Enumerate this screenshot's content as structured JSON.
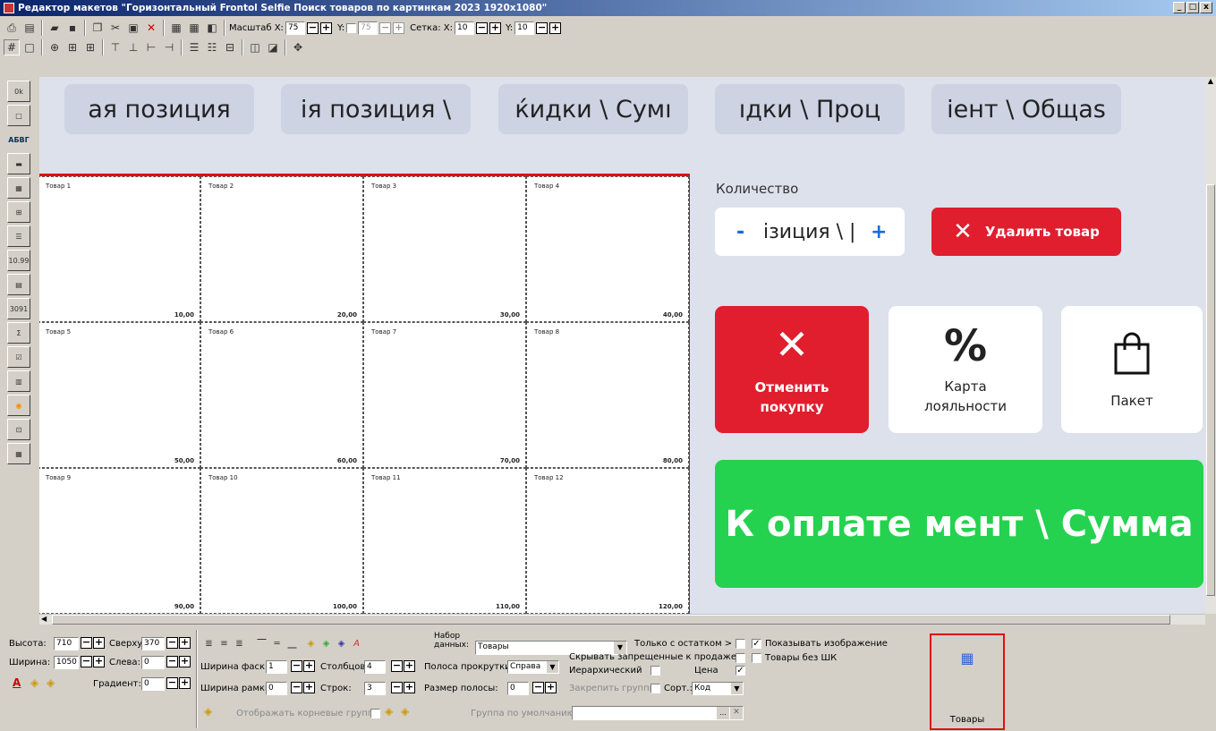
{
  "window": {
    "title": "Редактор макетов \"Горизонтальный Frontol Selfie Поиск товаров по картинкам 2023 1920x1080\"",
    "min": "_",
    "max": "□",
    "close": "x"
  },
  "toolbar1": {
    "scale_label": "Масштаб X:",
    "scale_x": "75",
    "y_label": "Y:",
    "scale_y": "75",
    "grid_label": "Сетка: X:",
    "grid_x": "10",
    "grid_y_label": "Y:",
    "grid_y": "10"
  },
  "left_tools": [
    "0k",
    "",
    "АБВГ",
    "",
    "",
    "",
    "",
    "10.99",
    "",
    "3091",
    "Σ",
    "",
    "",
    "",
    "",
    ""
  ],
  "canvas": {
    "pills": [
      "ая позиция",
      "ія позиция \\",
      "ќидки \\ Сумı",
      "ıдки \\ Проц",
      "іент \\ Общаs"
    ],
    "goods": [
      {
        "name": "Товар 1",
        "price": "10,00"
      },
      {
        "name": "Товар 2",
        "price": "20,00"
      },
      {
        "name": "Товар 3",
        "price": "30,00"
      },
      {
        "name": "Товар 4",
        "price": "40,00"
      },
      {
        "name": "Товар 5",
        "price": "50,00"
      },
      {
        "name": "Товар 6",
        "price": "60,00"
      },
      {
        "name": "Товар 7",
        "price": "70,00"
      },
      {
        "name": "Товар 8",
        "price": "80,00"
      },
      {
        "name": "Товар 9",
        "price": "90,00"
      },
      {
        "name": "Товар 10",
        "price": "100,00"
      },
      {
        "name": "Товар 11",
        "price": "110,00"
      },
      {
        "name": "Товар 12",
        "price": "120,00"
      }
    ],
    "qty_label": "Количество",
    "qty_minus": "-",
    "qty_value": "ізиция \\ |",
    "qty_plus": "+",
    "delete_label": "Удалить товар",
    "cancel_label": "Отменить покупку",
    "loyalty_label": "Карта лояльности",
    "bag_label": "Пакет",
    "loyalty_symbol": "%",
    "pay_label": "К оплате  мент \\ Сумма"
  },
  "props": {
    "height_label": "Высота:",
    "height": "710",
    "top_label": "Сверху:",
    "top": "370",
    "width_label": "Ширина:",
    "width": "1050",
    "left_label": "Слева:",
    "left": "0",
    "gradient_label": "Градиент:",
    "gradient": "0",
    "bevel_label": "Ширина фаски:",
    "bevel": "1",
    "cols_label": "Столбцов:",
    "cols": "4",
    "frame_label": "Ширина рамки:",
    "frame": "0",
    "rows_label": "Строк:",
    "rows": "3",
    "scroll_label": "Полоса прокрутки:",
    "scroll": "Справа",
    "stripe_label": "Размер полосы:",
    "stripe": "0",
    "root_label": "Отображать корневые группы",
    "dataset_label": "Набор данных:",
    "dataset": "Товары",
    "only_stock": "Только с остатком > 0",
    "show_image": "Показывать изображение",
    "hide_forbidden": "Скрывать запрещенные к продаже",
    "no_barcode": "Товары без ШК",
    "hierarchical": "Иерархический",
    "price": "Цена",
    "pin_groups": "Закрепить группы",
    "sort_label": "Сорт.:",
    "sort": "Код",
    "default_group": "Группа по умолчанию:",
    "preview_label": "Товары"
  }
}
